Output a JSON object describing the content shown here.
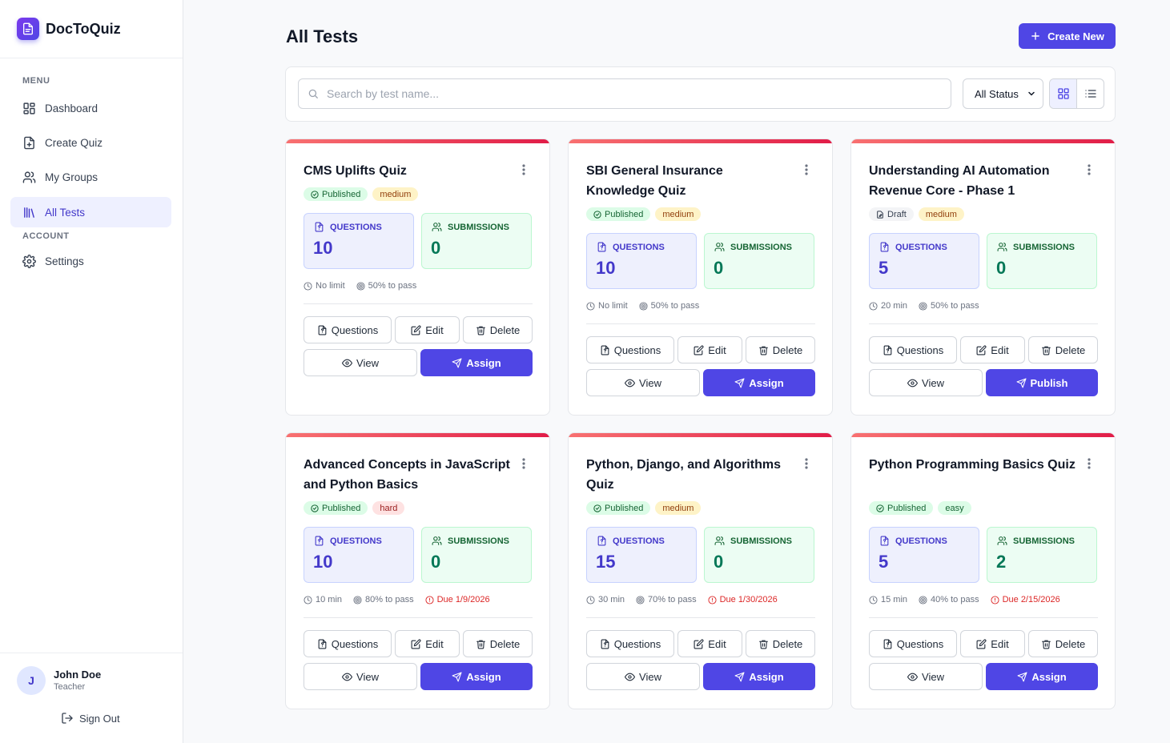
{
  "app": {
    "name": "DocToQuiz"
  },
  "sidebar": {
    "menu_label": "MENU",
    "account_label": "ACCOUNT",
    "items": [
      {
        "label": "Dashboard"
      },
      {
        "label": "Create Quiz"
      },
      {
        "label": "My Groups"
      },
      {
        "label": "All Tests"
      },
      {
        "label": "Settings"
      }
    ],
    "active_item": "All Tests"
  },
  "user": {
    "initial": "J",
    "name": "John Doe",
    "role": "Teacher",
    "signout_label": "Sign Out"
  },
  "header": {
    "title": "All Tests",
    "create_label": "Create New"
  },
  "filters": {
    "search_placeholder": "Search by test name...",
    "status_value": "All Status",
    "status_options": [
      "All Status"
    ],
    "view_mode": "grid"
  },
  "card_actions": {
    "questions": "Questions",
    "edit": "Edit",
    "delete": "Delete",
    "view": "View"
  },
  "stat_labels": {
    "questions": "QUESTIONS",
    "submissions": "SUBMISSIONS"
  },
  "colors": {
    "accent": "#4f46e5",
    "card_top_bar": "#e11d48",
    "due": "#dc2626"
  },
  "tests": [
    {
      "title": "CMS Uplifts Quiz",
      "status": "Published",
      "difficulty": "medium",
      "questions": "10",
      "submissions": "0",
      "time": "No limit",
      "pass": "50% to pass",
      "due": "",
      "primary_action": "Assign"
    },
    {
      "title": "SBI General Insurance Knowledge Quiz",
      "status": "Published",
      "difficulty": "medium",
      "questions": "10",
      "submissions": "0",
      "time": "No limit",
      "pass": "50% to pass",
      "due": "",
      "primary_action": "Assign"
    },
    {
      "title": "Understanding AI Automation Revenue Core - Phase 1",
      "status": "Draft",
      "difficulty": "medium",
      "questions": "5",
      "submissions": "0",
      "time": "20 min",
      "pass": "50% to pass",
      "due": "",
      "primary_action": "Publish"
    },
    {
      "title": "Advanced Concepts in JavaScript and Python Basics",
      "status": "Published",
      "difficulty": "hard",
      "questions": "10",
      "submissions": "0",
      "time": "10 min",
      "pass": "80% to pass",
      "due": "Due 1/9/2026",
      "primary_action": "Assign"
    },
    {
      "title": "Python, Django, and Algorithms Quiz",
      "status": "Published",
      "difficulty": "medium",
      "questions": "15",
      "submissions": "0",
      "time": "30 min",
      "pass": "70% to pass",
      "due": "Due 1/30/2026",
      "primary_action": "Assign"
    },
    {
      "title": "Python Programming Basics Quiz",
      "status": "Published",
      "difficulty": "easy",
      "questions": "5",
      "submissions": "2",
      "time": "15 min",
      "pass": "40% to pass",
      "due": "Due 2/15/2026",
      "primary_action": "Assign"
    }
  ]
}
